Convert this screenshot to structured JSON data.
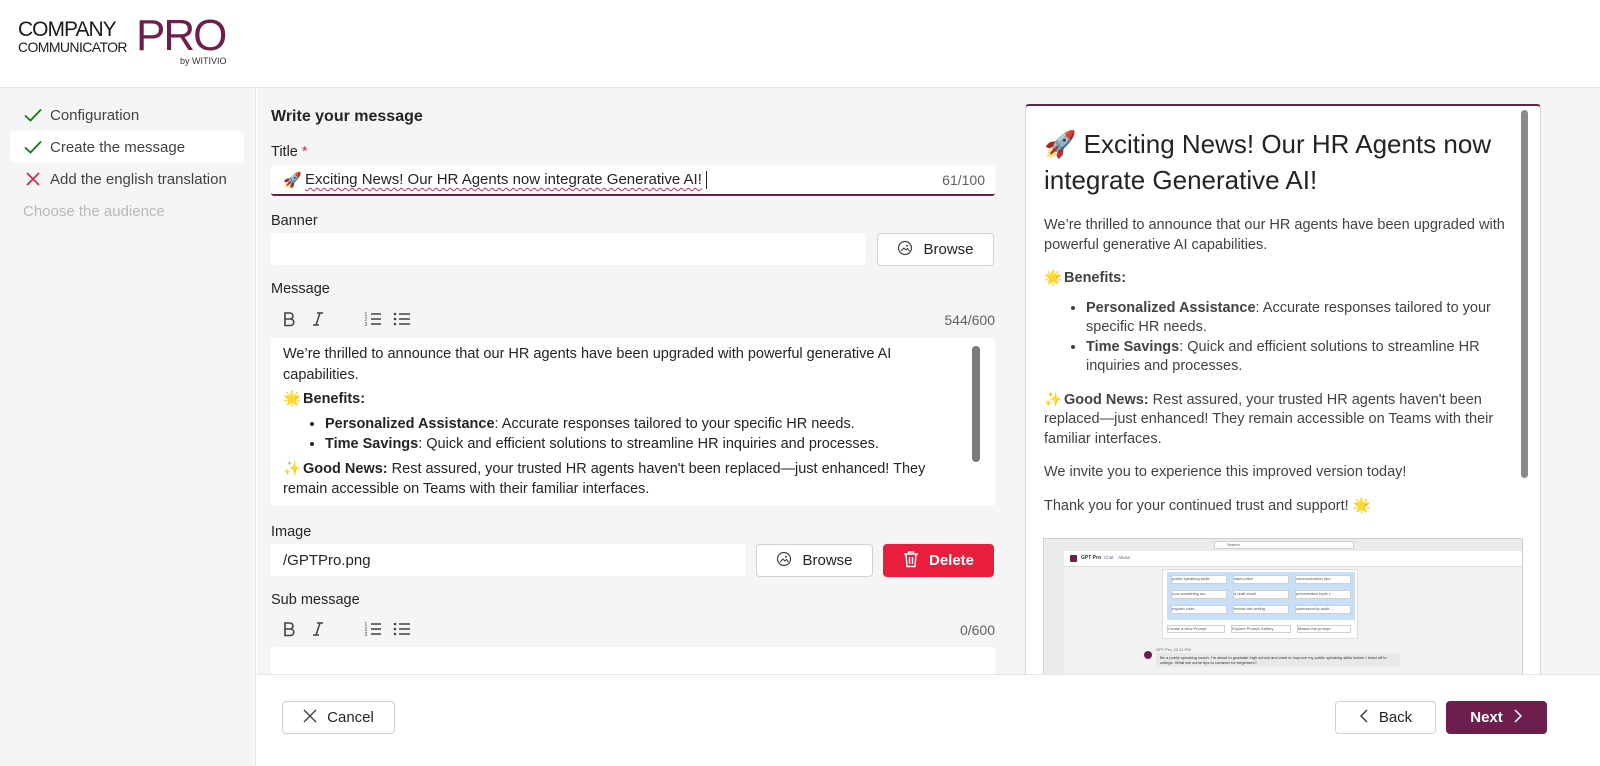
{
  "brand": {
    "line1": "COMPANY",
    "line2": "COMMUNICATOR",
    "pro": "PRO",
    "by": "by WITIVIO",
    "accent": "#6e1e4e",
    "danger": "#e81e3c"
  },
  "steps": [
    {
      "label": "Configuration",
      "status": "done",
      "icon": "check-icon"
    },
    {
      "label": "Create the message",
      "status": "active",
      "icon": "check-icon"
    },
    {
      "label": "Add the english translation",
      "status": "error",
      "icon": "x-icon"
    },
    {
      "label": "Choose the audience",
      "status": "disabled",
      "icon": ""
    }
  ],
  "form": {
    "heading": "Write your message",
    "title_label": "Title",
    "title_required": "*",
    "title_emoji": "🚀",
    "title_value": "Exciting News! Our HR Agents now integrate Generative AI!",
    "title_counter": "61/100",
    "banner_label": "Banner",
    "banner_value": "",
    "browse_label": "Browse",
    "message_label": "Message",
    "message_counter": "544/600",
    "message": {
      "intro": "We’re thrilled to announce that our HR agents have been upgraded with powerful generative AI capabilities.",
      "benefits_emoji": "🌟",
      "benefits_heading": "Benefits:",
      "bullets": [
        {
          "bold": "Personalized Assistance",
          "text": ": Accurate responses tailored to your specific HR needs."
        },
        {
          "bold": "Time Savings",
          "text": ": Quick and efficient solutions to streamline HR inquiries and processes."
        }
      ],
      "good_emoji": "✨",
      "good_bold": "Good News:",
      "good_text": " Rest assured, your trusted HR agents haven't been replaced—just enhanced! They remain accessible on Teams with their familiar interfaces."
    },
    "image_label": "Image",
    "image_value": "/GPTPro.png",
    "delete_label": "Delete",
    "submessage_label": "Sub message",
    "submessage_counter": "0/600"
  },
  "preview": {
    "title_emoji": "🚀",
    "title": "Exciting News! Our HR Agents now integrate Generative AI!",
    "intro": "We’re thrilled to announce that our HR agents have been upgraded with powerful generative AI capabilities.",
    "benefits_emoji": "🌟",
    "benefits_heading": "Benefits:",
    "bullets": [
      {
        "bold": "Personalized Assistance",
        "text": ": Accurate responses tailored to your specific HR needs."
      },
      {
        "bold": "Time Savings",
        "text": ": Quick and efficient solutions to streamline HR inquiries and processes."
      }
    ],
    "good_emoji": "✨",
    "good_bold": "Good News:",
    "good_text": " Rest assured, your trusted HR agents haven't been replaced—just enhanced! They remain accessible on Teams with their familiar interfaces.",
    "invite": "We invite you to experience this improved version today!",
    "thanks": "Thank you for your continued trust and support!",
    "thanks_emoji": "🌟",
    "shot": {
      "app_name": "GPT Pro",
      "tab_chat": "Chat",
      "tab_about": "About",
      "search": "Search",
      "chips": [
        "public speaking skills",
        "sales pitch",
        "communication tips",
        "how something wo...",
        "a draft email",
        "presentation topic i...",
        "explain code",
        "review the writing",
        "cybersecurity audit ..."
      ],
      "links": [
        "Create a New Prompt",
        "Explore Prompt Gallery",
        "Master the prompt"
      ],
      "sender": "GPT Pro, 12:11 PM",
      "msg": "Be a public speaking coach. I'm about to graduate high school and want to improve my public speaking skills before I head off to college. What are some tips to consider for beginners?"
    }
  },
  "footer": {
    "cancel": "Cancel",
    "back": "Back",
    "next": "Next"
  }
}
